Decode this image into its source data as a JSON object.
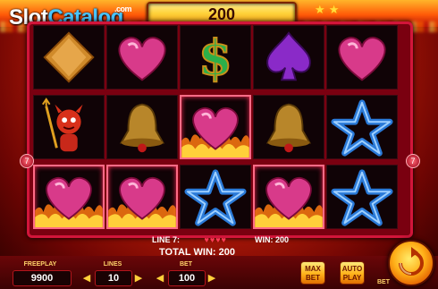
{
  "logo": {
    "part1": "Slot",
    "part2": "Catalog",
    "suffix": ".com"
  },
  "top": {
    "bet_display": "200",
    "stars": "★ ★"
  },
  "reels": {
    "rows": [
      [
        "diamond",
        "heart",
        "dollar",
        "spade",
        "heart"
      ],
      [
        "devil",
        "bell",
        "heart",
        "bell",
        "star"
      ],
      [
        "heart",
        "heart",
        "star",
        "heart",
        "star"
      ]
    ],
    "winning_cells": [
      [
        1,
        2
      ],
      [
        2,
        0
      ],
      [
        2,
        1
      ],
      [
        2,
        3
      ]
    ]
  },
  "side_badges": {
    "left": "7",
    "right": "7"
  },
  "win_info": {
    "line_label": "LINE 7:",
    "line_symbols": "♥♥♥♥",
    "win_label": "WIN: 200",
    "total_label": "TOTAL WIN: 200"
  },
  "bottom": {
    "freeplay_label": "FREEPLAY",
    "freeplay_value": "9900",
    "lines_label": "LINES",
    "lines_value": "10",
    "bet_label": "BET",
    "bet_value": "100",
    "max_bet_label": "MAX BET",
    "auto_play_label": "AUTO PLAY",
    "bet_small_label": "BET"
  },
  "colors": {
    "accent": "#ffd23a",
    "frame": "#d2153a",
    "background": "#d4250a",
    "heart": "#e8307a",
    "star": "#2a7ad8"
  }
}
